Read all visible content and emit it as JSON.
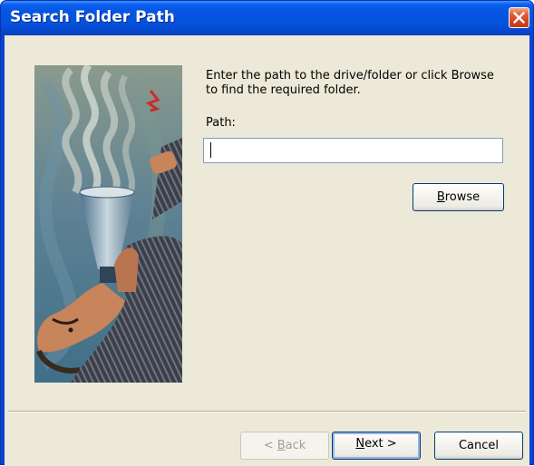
{
  "window": {
    "title": "Search Folder Path"
  },
  "icons": {
    "close": "close-icon"
  },
  "content": {
    "instructions": "Enter the path to the drive/folder or click Browse to find the required folder.",
    "path_label": "Path:",
    "path_value": "",
    "browse_prefix": "",
    "browse_accel": "B",
    "browse_rest": "rowse"
  },
  "buttons": {
    "back_prefix": "< ",
    "back_accel": "B",
    "back_rest": "ack",
    "next_prefix": "",
    "next_accel": "N",
    "next_rest": "ext >",
    "cancel": "Cancel"
  },
  "colors": {
    "title_bar": "#0a5fee",
    "dialog_background": "#ece9d8",
    "close_button": "#e35a33",
    "button_border": "#003c74"
  }
}
